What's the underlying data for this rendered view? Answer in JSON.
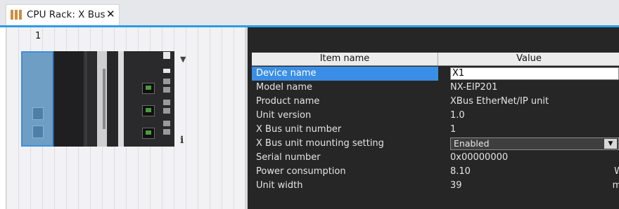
{
  "tab": {
    "title": "CPU Rack: X Bus",
    "close": "✕"
  },
  "rack": {
    "slot_number": "1",
    "dropdown": "▼",
    "info": "i"
  },
  "properties": {
    "headers": {
      "item_name": "Item name",
      "value": "Value"
    },
    "rows": [
      {
        "name": "Device name",
        "value": "X1"
      },
      {
        "name": "Model name",
        "value": "NX-EIP201"
      },
      {
        "name": "Product name",
        "value": "XBus EtherNet/IP unit"
      },
      {
        "name": "Unit version",
        "value": "1.0"
      },
      {
        "name": "X Bus unit number",
        "value": "1"
      },
      {
        "name": "X Bus unit mounting setting",
        "value": "Enabled"
      },
      {
        "name": "Serial number",
        "value": "0x00000000"
      },
      {
        "name": "Power consumption",
        "value": "8.10",
        "unit": "W"
      },
      {
        "name": "Unit width",
        "value": "39",
        "unit": "mm"
      }
    ],
    "select_arrow": "▼"
  },
  "colors": {
    "accent": "#2d9ce6",
    "selection": "#3a8ee6",
    "panel_bg": "#262626"
  }
}
